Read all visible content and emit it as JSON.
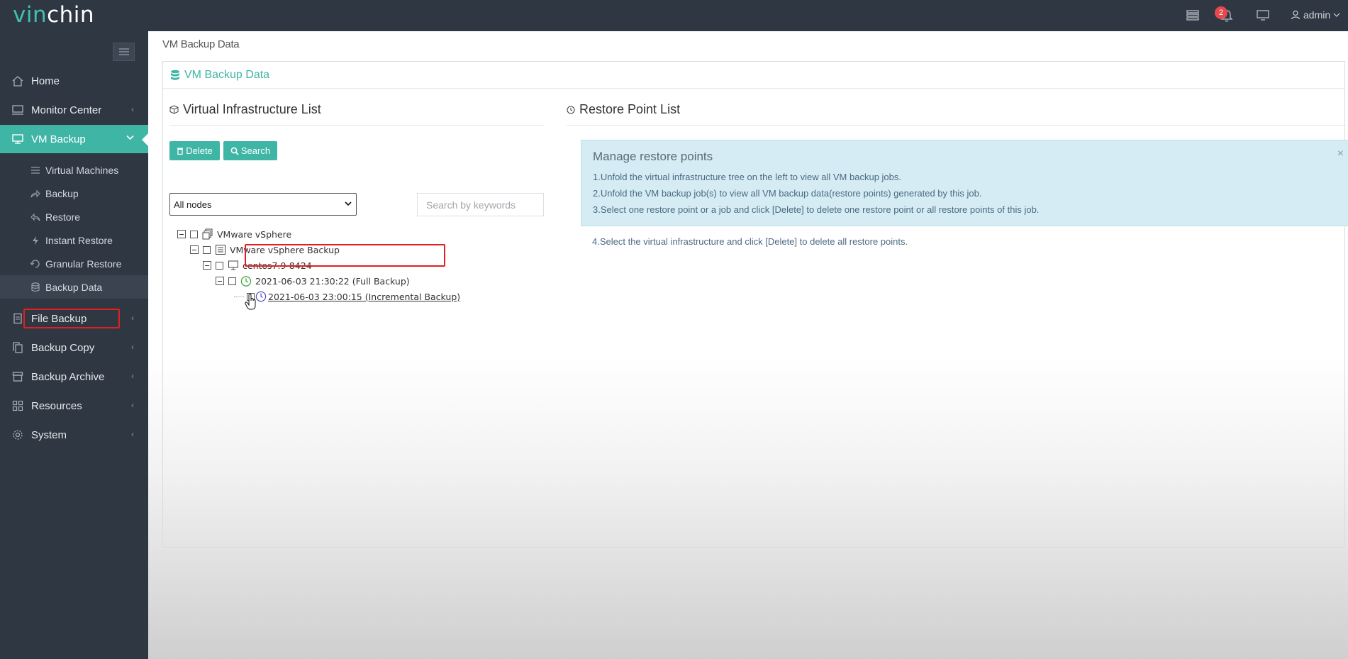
{
  "app": {
    "logo_accent": "vin",
    "logo_rest": "chin",
    "notification_count": "2",
    "user": "admin"
  },
  "colors": {
    "accent": "#3fb5a6",
    "sidebar_bg": "#2f3743",
    "highlight": "#e02020"
  },
  "sidebar": {
    "items": [
      {
        "label": "Home",
        "icon": "home-icon"
      },
      {
        "label": "Monitor Center",
        "icon": "monitor-icon"
      },
      {
        "label": "VM Backup",
        "icon": "desktop-icon"
      },
      {
        "label": "File Backup",
        "icon": "file-icon"
      },
      {
        "label": "Backup Copy",
        "icon": "copy-icon"
      },
      {
        "label": "Backup Archive",
        "icon": "archive-icon"
      },
      {
        "label": "Resources",
        "icon": "grid-icon"
      },
      {
        "label": "System",
        "icon": "gear-icon"
      }
    ],
    "subitems": [
      {
        "label": "Virtual Machines",
        "icon": "list-icon"
      },
      {
        "label": "Backup",
        "icon": "share-icon"
      },
      {
        "label": "Restore",
        "icon": "reply-icon"
      },
      {
        "label": "Instant Restore",
        "icon": "bolt-icon"
      },
      {
        "label": "Granular Restore",
        "icon": "undo-icon"
      },
      {
        "label": "Backup Data",
        "icon": "database-icon"
      }
    ]
  },
  "main": {
    "breadcrumb": "VM Backup Data",
    "panel_title": "VM Backup Data",
    "left": {
      "title": "Virtual Infrastructure List",
      "delete_label": "Delete",
      "search_label": "Search",
      "node_select": "All nodes",
      "search_placeholder": "Search by keywords",
      "tree": [
        {
          "label": "VMware vSphere"
        },
        {
          "label": "VMware vSphere Backup"
        },
        {
          "label": "centos7.9-8424"
        },
        {
          "label": "2021-06-03 21:30:22 (Full Backup)"
        },
        {
          "label": "2021-06-03 23:00:15 (Incremental Backup)"
        }
      ]
    },
    "right": {
      "title": "Restore Point List",
      "info_title": "Manage restore points",
      "info_lines": [
        "1.Unfold the virtual infrastructure tree on the left to view all VM backup jobs.",
        "2.Unfold the VM backup job(s) to view all VM backup data(restore points) generated by this job.",
        "3.Select one restore point or a job and click [Delete] to delete one restore point or all restore points of this job.",
        "4.Select the virtual infrastructure and click [Delete] to delete all restore points."
      ]
    }
  }
}
